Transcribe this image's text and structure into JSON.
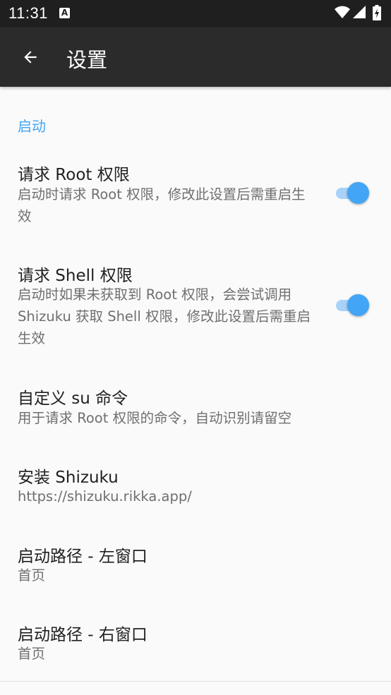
{
  "status_bar": {
    "time": "11:31",
    "notification_icon": "a-icon",
    "icons": [
      "wifi-icon",
      "signal-icon",
      "battery-charging-icon"
    ]
  },
  "app_bar": {
    "back_icon": "arrow-back-icon",
    "title": "设置"
  },
  "colors": {
    "accent": "#42a5f5",
    "toolbar": "#2b2b2b",
    "status_bar": "#1f1f1f",
    "background": "#fafafa"
  },
  "category": {
    "title": "启动"
  },
  "prefs": {
    "root": {
      "title": "请求 Root 权限",
      "summary": "启动时请求 Root 权限，修改此设置后需重启生效",
      "enabled": true
    },
    "shell": {
      "title": "请求 Shell 权限",
      "summary": "启动时如果未获取到 Root 权限，会尝试调用 Shizuku 获取 Shell 权限，修改此设置后需重启生效",
      "enabled": true
    },
    "su": {
      "title": "自定义 su 命令",
      "summary": "用于请求 Root 权限的命令，自动识别请留空"
    },
    "shizuku": {
      "title": "安装 Shizuku",
      "summary": "https://shizuku.rikka.app/"
    },
    "left_path": {
      "title": "启动路径 - 左窗口",
      "summary": "首页"
    },
    "right_path": {
      "title": "启动路径 - 右窗口",
      "summary": "首页"
    }
  }
}
